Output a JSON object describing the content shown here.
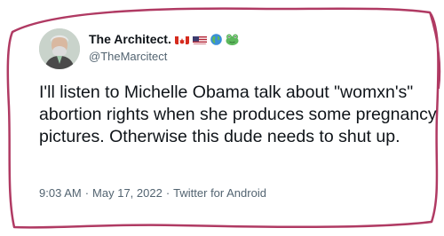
{
  "tweet": {
    "display_name": "The Architect.",
    "badges": [
      "canada-flag-icon",
      "us-flag-icon",
      "globe-icon",
      "frog-icon"
    ],
    "handle": "@TheMarcitect",
    "text": "I'll listen to Michelle Obama talk about \"womxn's\" abortion rights when she produces some pregnancy pictures. Otherwise this dude needs to shut up.",
    "time": "9:03 AM",
    "separator": "·",
    "date": "May 17, 2022",
    "source": "Twitter for Android"
  },
  "colors": {
    "annotation_outline": "#b03a63",
    "text_primary": "#0f1419",
    "text_secondary": "#536471"
  }
}
